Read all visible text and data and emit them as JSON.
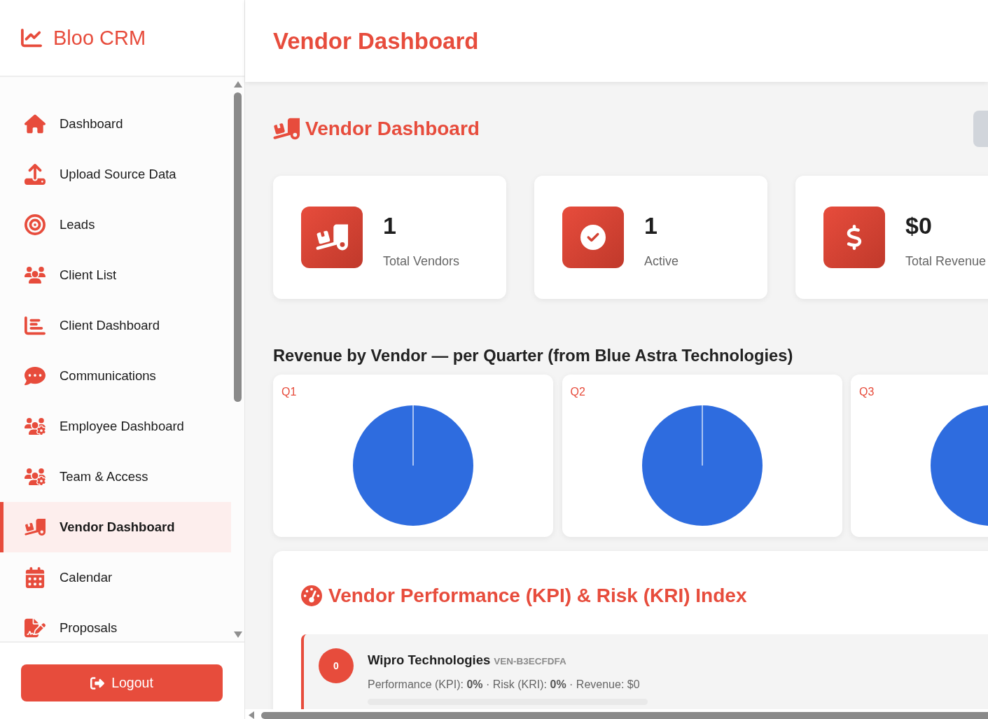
{
  "sidebar": {
    "brand": "Bloo CRM",
    "nav_items": [
      {
        "label": "Dashboard",
        "selected": false
      },
      {
        "label": "Upload Source Data",
        "selected": false
      },
      {
        "label": "Leads",
        "selected": false
      },
      {
        "label": "Client List",
        "selected": false
      },
      {
        "label": "Client Dashboard",
        "selected": false
      },
      {
        "label": "Communications",
        "selected": false
      },
      {
        "label": "Employee Dashboard",
        "selected": false
      },
      {
        "label": "Team & Access",
        "selected": false
      },
      {
        "label": "Vendor Dashboard",
        "selected": true
      },
      {
        "label": "Calendar",
        "selected": false
      },
      {
        "label": "Proposals",
        "selected": false
      }
    ],
    "logout_button": "Logout"
  },
  "header": {
    "title": "Vendor Dashboard"
  },
  "dashboard": {
    "title": "Vendor Dashboard",
    "stats": [
      {
        "value": "1",
        "label": "Total Vendors"
      },
      {
        "value": "1",
        "label": "Active"
      },
      {
        "value": "$0",
        "label": "Total Revenue"
      }
    ],
    "revenue_by_vendor": {
      "title": "Revenue by Vendor — per Quarter (from Blue Astra Technologies)",
      "quarters": [
        {
          "title": "Q1"
        },
        {
          "title": "Q2"
        },
        {
          "title": "Q3"
        }
      ]
    },
    "kpi_index": {
      "title": "Vendor Performance (KPI) & Risk (KRI) Index",
      "vendors": [
        {
          "score": "0",
          "name": "Wipro Technologies",
          "code": "VEN-B3ECFDFA",
          "summary": "Performance (KPI): **0%** · Risk (KRI): **0%** · Revenue: $0",
          "level": 0
        }
      ]
    }
  }
}
